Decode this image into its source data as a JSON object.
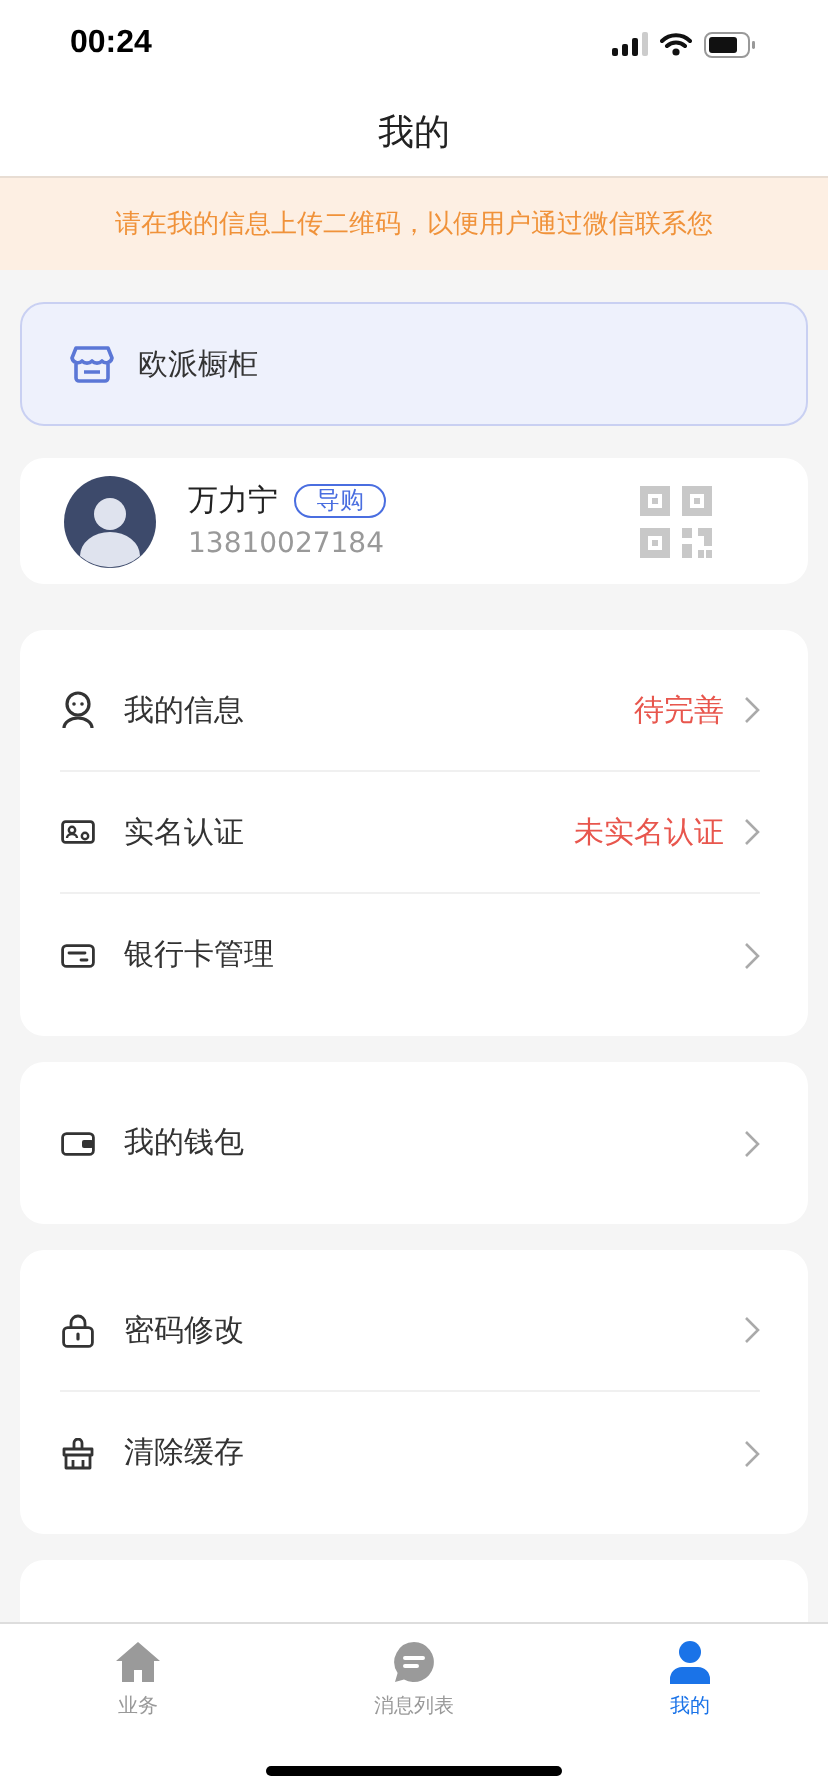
{
  "status_bar": {
    "time": "00:24"
  },
  "header": {
    "title": "我的"
  },
  "notice": "请在我的信息上传二维码，以便用户通过微信联系您",
  "store": {
    "name": "欧派橱柜"
  },
  "profile": {
    "name": "万力宁",
    "role": "导购",
    "phone": "13810027184"
  },
  "menu_groups": [
    [
      {
        "label": "我的信息",
        "status": "待完善"
      },
      {
        "label": "实名认证",
        "status": "未实名认证"
      },
      {
        "label": "银行卡管理"
      }
    ],
    [
      {
        "label": "我的钱包"
      }
    ],
    [
      {
        "label": "密码修改"
      },
      {
        "label": "清除缓存"
      }
    ]
  ],
  "tabs": [
    {
      "label": "业务",
      "selected": false
    },
    {
      "label": "消息列表",
      "selected": false
    },
    {
      "label": "我的",
      "selected": true
    }
  ]
}
